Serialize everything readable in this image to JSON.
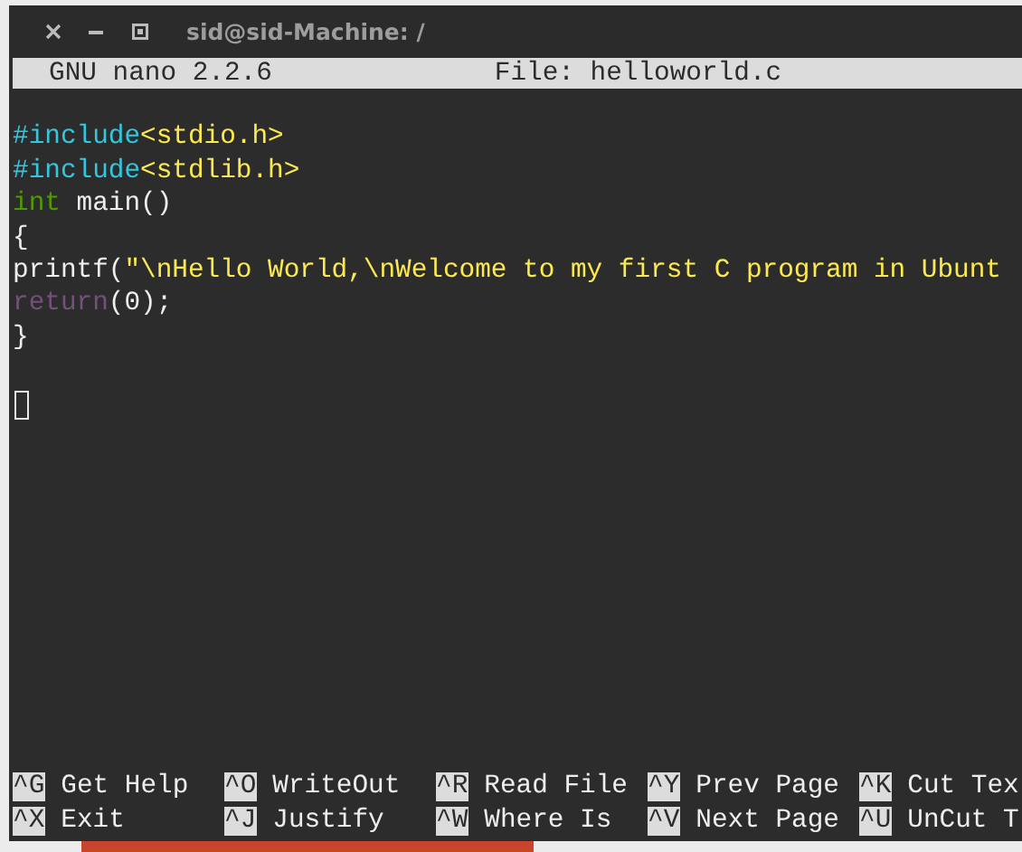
{
  "window": {
    "title": "sid@sid-Machine: /"
  },
  "header": {
    "version": "GNU nano 2.2.6",
    "file": "File: helloworld.c"
  },
  "lines": [
    {
      "kind": "blank"
    },
    {
      "kind": "code",
      "segments": [
        {
          "text": "#include",
          "color": "#33c7de"
        },
        {
          "text": "<stdio.h>",
          "color": "#fce94f"
        }
      ]
    },
    {
      "kind": "code",
      "segments": [
        {
          "text": "#include",
          "color": "#33c7de"
        },
        {
          "text": "<stdlib.h>",
          "color": "#fce94f"
        }
      ]
    },
    {
      "kind": "code",
      "segments": [
        {
          "text": "int",
          "color": "#4e9a06"
        },
        {
          "text": " main()",
          "color": "#eeeeec"
        }
      ]
    },
    {
      "kind": "code",
      "segments": [
        {
          "text": "{",
          "color": "#eeeeec"
        }
      ]
    },
    {
      "kind": "code",
      "segments": [
        {
          "text": "printf(",
          "color": "#eeeeec"
        },
        {
          "text": "\"\\nHello World,\\nWelcome to my first C program in Ubunt",
          "color": "#fce94f"
        }
      ]
    },
    {
      "kind": "code",
      "segments": [
        {
          "text": "return",
          "color": "#75507b"
        },
        {
          "text": "(0);",
          "color": "#eeeeec"
        }
      ]
    },
    {
      "kind": "code",
      "segments": [
        {
          "text": "}",
          "color": "#eeeeec"
        }
      ]
    },
    {
      "kind": "blank"
    },
    {
      "kind": "cursor"
    }
  ],
  "shortcuts": [
    [
      {
        "key": "^G",
        "label": "Get Help"
      },
      {
        "key": "^O",
        "label": "WriteOut"
      },
      {
        "key": "^R",
        "label": "Read File"
      },
      {
        "key": "^Y",
        "label": "Prev Page"
      },
      {
        "key": "^K",
        "label": "Cut Tex"
      }
    ],
    [
      {
        "key": "^X",
        "label": "Exit"
      },
      {
        "key": "^J",
        "label": "Justify"
      },
      {
        "key": "^W",
        "label": "Where Is"
      },
      {
        "key": "^V",
        "label": "Next Page"
      },
      {
        "key": "^U",
        "label": "UnCut T"
      }
    ]
  ]
}
